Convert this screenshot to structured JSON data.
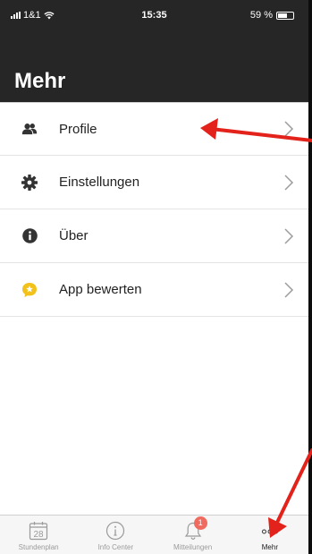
{
  "status": {
    "carrier": "1&1",
    "time": "15:35",
    "battery": "59 %"
  },
  "header": {
    "title": "Mehr"
  },
  "menu": {
    "items": [
      {
        "label": "Profile",
        "icon": "users-icon"
      },
      {
        "label": "Einstellungen",
        "icon": "gear-icon"
      },
      {
        "label": "Über",
        "icon": "info-icon"
      },
      {
        "label": "App bewerten",
        "icon": "star-bubble-icon"
      }
    ]
  },
  "tabs": [
    {
      "label": "Stundenplan",
      "icon": "calendar-icon",
      "day": "28"
    },
    {
      "label": "Info Center",
      "icon": "info-circle-icon"
    },
    {
      "label": "Mitteilungen",
      "icon": "bell-icon",
      "badge": "1"
    },
    {
      "label": "Mehr",
      "icon": "more-dots-icon",
      "active": true
    }
  ],
  "colors": {
    "header_bg": "#262626",
    "accent_yellow": "#f2c21b",
    "badge_red": "#ef6b5f",
    "annotation_red": "#e3231b"
  }
}
